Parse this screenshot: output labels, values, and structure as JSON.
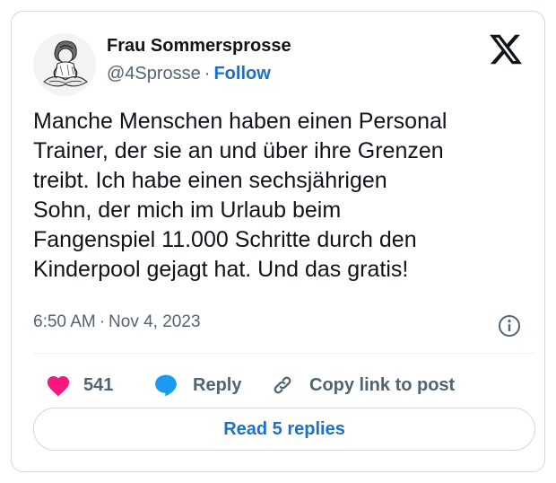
{
  "author": {
    "display_name": "Frau Sommersprosse",
    "handle": "@4Sprosse",
    "separator": "·",
    "follow_label": "Follow"
  },
  "platform_icon": "x-logo-icon",
  "tweet": {
    "text": "Manche Menschen haben einen Personal\nTrainer, der sie an und über ihre Grenzen\ntreibt. Ich habe einen sechsjährigen\nSohn, der mich im Urlaub beim\nFangenspiel 11.000 Schritte durch den\nKinderpool gejagt hat. Und das gratis!",
    "time": "6:50 AM",
    "separator": "·",
    "date": "Nov 4, 2023",
    "info_icon": "info-icon"
  },
  "actions": {
    "like_count": "541",
    "like_icon": "heart-icon",
    "reply_label": "Reply",
    "reply_icon": "speech-bubble-icon",
    "copy_label": "Copy link to post",
    "copy_icon": "link-icon"
  },
  "read_replies_label": "Read 5 replies",
  "colors": {
    "text": "#0f1419",
    "secondary": "#536471",
    "link": "#1d6fc8",
    "like": "#f91880",
    "reply": "#1d9bf0",
    "border": "#cfd9de"
  }
}
